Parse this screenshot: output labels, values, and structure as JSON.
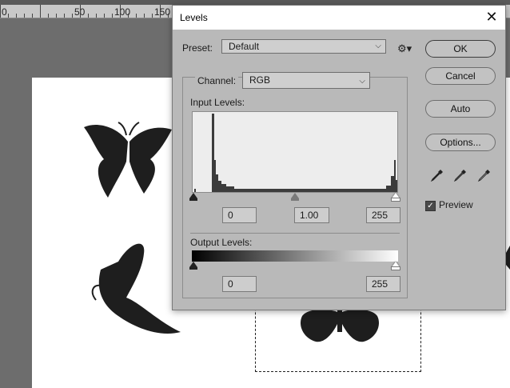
{
  "ruler": {
    "labels": [
      "0",
      "50",
      "100",
      "150"
    ]
  },
  "dialog": {
    "title": "Levels",
    "preset_label": "Preset:",
    "preset_value": "Default",
    "channel_label": "Channel:",
    "channel_value": "RGB",
    "input_levels_label": "Input Levels:",
    "input_black": "0",
    "input_gamma": "1.00",
    "input_white": "255",
    "output_levels_label": "Output Levels:",
    "output_black": "0",
    "output_white": "255",
    "buttons": {
      "ok": "OK",
      "cancel": "Cancel",
      "auto": "Auto",
      "options": "Options..."
    },
    "preview_label": "Preview",
    "preview_checked": true
  },
  "icons": [
    "close-icon",
    "gear-icon",
    "chevron-down-icon",
    "black-eyedropper-icon",
    "gray-eyedropper-icon",
    "white-eyedropper-icon",
    "checkbox-icon",
    "butterfly-icon"
  ]
}
